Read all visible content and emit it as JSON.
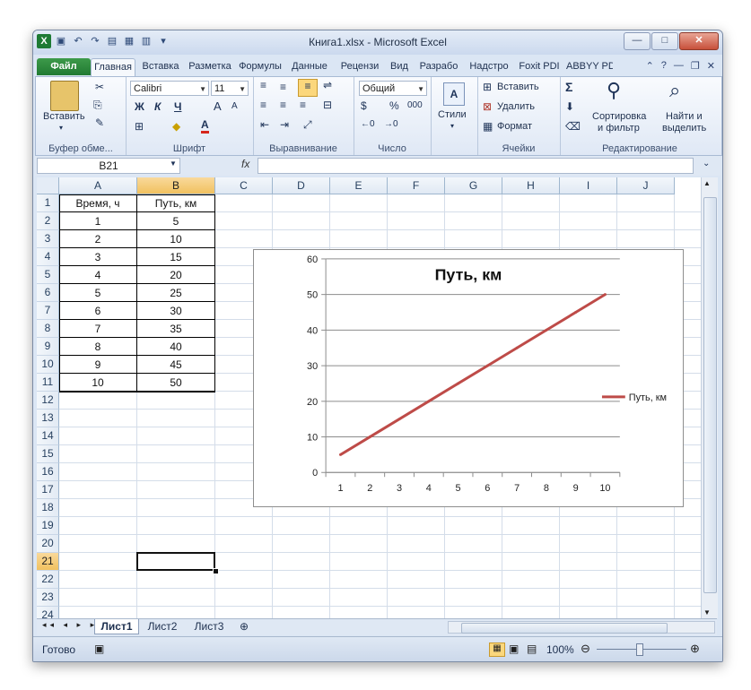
{
  "window": {
    "title": "Книга1.xlsx  -  Microsoft Excel"
  },
  "qat": {
    "undo_icon": "undo-icon",
    "redo_icon": "redo-icon",
    "save_icon": "save-icon"
  },
  "tabs": [
    "Файл",
    "Главная",
    "Вставка",
    "Разметка",
    "Формулы",
    "Данные",
    "Рецензи",
    "Вид",
    "Разрабо",
    "Надстро",
    "Foxit PDI",
    "ABBYY PD"
  ],
  "ribbon": {
    "clipboard": {
      "paste": "Вставить",
      "group": "Буфер обме..."
    },
    "font": {
      "name": "Calibri",
      "size": "11",
      "bold": "Ж",
      "italic": "К",
      "underline": "Ч",
      "grow": "A",
      "shrink": "A",
      "group": "Шрифт"
    },
    "alignment": {
      "group": "Выравнивание"
    },
    "number": {
      "format": "Общий",
      "percent": "%",
      "thousands": "000",
      "group": "Число"
    },
    "styles": {
      "label": "Стили"
    },
    "cells": {
      "insert": "Вставить",
      "delete": "Удалить",
      "format": "Формат",
      "group": "Ячейки"
    },
    "editing": {
      "sum": "Σ",
      "sort_line1": "Сортировка",
      "sort_line2": "и фильтр",
      "find_line1": "Найти и",
      "find_line2": "выделить",
      "group": "Редактирование"
    }
  },
  "formula_bar": {
    "name_box": "B21",
    "fx": "fx",
    "content": ""
  },
  "columns": [
    "A",
    "B",
    "C",
    "D",
    "E",
    "F",
    "G",
    "H",
    "I",
    "J"
  ],
  "rows": [
    "1",
    "2",
    "3",
    "4",
    "5",
    "6",
    "7",
    "8",
    "9",
    "10",
    "11",
    "12",
    "13",
    "14",
    "15",
    "16",
    "17",
    "18",
    "19",
    "20",
    "21",
    "22",
    "23",
    "24"
  ],
  "table": {
    "headers": [
      "Время, ч",
      "Путь, км"
    ],
    "rows": [
      [
        "1",
        "5"
      ],
      [
        "2",
        "10"
      ],
      [
        "3",
        "15"
      ],
      [
        "4",
        "20"
      ],
      [
        "5",
        "25"
      ],
      [
        "6",
        "30"
      ],
      [
        "7",
        "35"
      ],
      [
        "8",
        "40"
      ],
      [
        "9",
        "45"
      ],
      [
        "10",
        "50"
      ]
    ]
  },
  "chart_data": {
    "type": "line",
    "title": "Путь, км",
    "categories": [
      "1",
      "2",
      "3",
      "4",
      "5",
      "6",
      "7",
      "8",
      "9",
      "10"
    ],
    "series": [
      {
        "name": "Путь, км",
        "values": [
          5,
          10,
          15,
          20,
          25,
          30,
          35,
          40,
          45,
          50
        ],
        "color": "#be4b48"
      }
    ],
    "ylim": [
      0,
      60
    ],
    "yticks": [
      "0",
      "10",
      "20",
      "30",
      "40",
      "50",
      "60"
    ],
    "grid": true,
    "legend": "right"
  },
  "sheets": [
    "Лист1",
    "Лист2",
    "Лист3"
  ],
  "status": {
    "ready": "Готово",
    "zoom": "100%"
  }
}
